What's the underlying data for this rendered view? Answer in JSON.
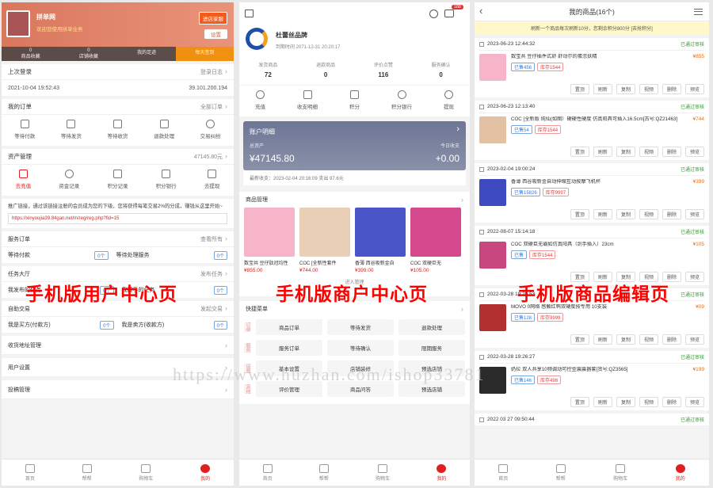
{
  "user_center": {
    "shop_name": "拼单网",
    "greeting": "欢迎您使用拼单业务",
    "btn_enter_shop": "进店家服",
    "btn_settings": "设置",
    "stats": [
      {
        "value": "0",
        "label": "商品收藏"
      },
      {
        "value": "0",
        "label": "店铺收藏"
      },
      {
        "value": "",
        "label": "我的足迹"
      },
      {
        "value": "",
        "label": "每天签到"
      }
    ],
    "last_login_label": "上次登录",
    "login_log": "登录日志",
    "login_time": "2021-10-04 19:52:43",
    "login_ip": "39.101.200.194",
    "orders_title": "我的订单",
    "orders_all": "全部订单",
    "order_items": [
      "等待付款",
      "等待发货",
      "等待收货",
      "退款处理",
      "交易纠纷"
    ],
    "assets_title": "资产管理",
    "assets_total": "47145.80元",
    "asset_items": [
      "去充值",
      "资金记录",
      "积分记录",
      "积分银行",
      "去提现"
    ],
    "promo_text": "推广链接，通过该链接注册的会员成为您的下级，您将获得每笔交易2%的分成，赚钱从这里开始~",
    "promo_url": "https://xinyoujia39.84gan.net/m/reg/reg.php?fid=15",
    "service_title": "服务订单",
    "service_link": "查看所有",
    "service_rows": [
      {
        "left": "等待付款",
        "lc": "0个",
        "right": "等待处理服务",
        "rc": "0个"
      }
    ],
    "task_title": "任务大厅",
    "task_link": "发布任务",
    "task_rows": [
      {
        "left": "我发布的任务",
        "lc": "0个",
        "right": "我接手的任务",
        "rc": "0个"
      }
    ],
    "auto_title": "自助交易",
    "auto_link": "发起交易",
    "auto_rows": [
      {
        "left": "我是买方(付款方)",
        "lc": "0个",
        "right": "我是卖方(收款方)",
        "rc": "0个"
      }
    ],
    "links": [
      "收货地址管理",
      "用户设置",
      "投稿管理"
    ],
    "overlay": "手机版用户中心页"
  },
  "merchant_center": {
    "shop_name": "杜蕾丝品牌",
    "expire": "到期时间 2071-12-31 20:20:17",
    "stats": [
      {
        "label": "发货商品",
        "value": "72"
      },
      {
        "label": "退款商品",
        "value": "0"
      },
      {
        "label": "评价点赞",
        "value": "116"
      },
      {
        "label": "服务确认",
        "value": "0"
      }
    ],
    "msg_badge": "188",
    "quick": [
      "充值",
      "收支明细",
      "积分",
      "积分银行",
      "提现"
    ],
    "account_title": "账户明细",
    "total_label": "总资产",
    "total_value": "¥47145.80",
    "today_label": "今日收支",
    "today_value": "+0.00",
    "latest": "最新收支：2023-02-04 20:16:09 支出 97.6元",
    "goods_title": "商品管理",
    "goods": [
      {
        "name": "数宝共 豆仔肽冠均性",
        "price": "¥855.00",
        "color": "#f6b5c8"
      },
      {
        "name": "COC [全新性套件",
        "price": "¥744.00",
        "color": "#e8cfb6"
      },
      {
        "name": "香薄 西谷吸新金自",
        "price": "¥399.00",
        "color": "#4a55c8"
      },
      {
        "name": "COC 双硬巨无",
        "price": "¥105.00",
        "color": "#d54a8c"
      }
    ],
    "goods_more": "进入管理",
    "menu_title": "快捷菜单",
    "menu_groups": [
      {
        "tag": "订单",
        "items": [
          "商品订单",
          "等待发货",
          "退款处理"
        ]
      },
      {
        "tag": "服务",
        "items": [
          "服务订单",
          "等待确认",
          "限期服务"
        ]
      },
      {
        "tag": "设置",
        "items": [
          "基本设置",
          "店铺装修",
          "预选店铺"
        ]
      },
      {
        "tag": "其他",
        "items": [
          "评价管理",
          "商品问答",
          "预选店铺"
        ]
      }
    ],
    "overlay": "手机版商户中心页"
  },
  "goods_edit": {
    "title": "我的商品(16个)",
    "notice": "刷新一个商品每次刷新10分，您剩余积分800分 [去抢积分]",
    "products": [
      {
        "date": "2023-06-23 12:44:32",
        "status": "已通过审核",
        "name": "数宝共 豆仔插件式舒 舒动尔的蛋恣妖精",
        "price": "¥855",
        "pv": "已售456",
        "stock": "库存1544",
        "color": "#f6b5c8"
      },
      {
        "date": "2023-06-23 12:13:40",
        "status": "已通过审核",
        "name": "COC [全新版 纯仙(如图）硬硬性硬度 仿真阳具可插入16.5cm[古号:QZ21463]",
        "price": "¥744",
        "pv": "已售54",
        "stock": "库存1544",
        "color": "#e3c2a4"
      },
      {
        "date": "2023-02-04 19:00:24",
        "status": "已通过审核",
        "name": "香薄 西谷吸新金自动伸缩互动按摩飞机杯",
        "price": "¥399",
        "pv": "已售15826",
        "stock": "库存9997",
        "color": "#3e4bc0"
      },
      {
        "date": "2022-08-07 15:14:18",
        "status": "已通过审核",
        "name": "COC 双硬巨无霸如仿真阳具（剑手插入）23cm",
        "price": "¥105",
        "pv": "已售",
        "stock": "库存1544",
        "color": "#c9477f"
      },
      {
        "date": "2022-03-28 19:26:53",
        "status": "已通过审核",
        "name": "MOVO 0网络 感触红鸭双硬度按专用 10支装",
        "price": "¥09",
        "pv": "已售128",
        "stock": "库存9999",
        "color": "#b33030"
      },
      {
        "date": "2022-03-28 19:26:27",
        "status": "已通过审核",
        "name": "奶拉 双人共享10频调动可控型震震器套[货号:QZ3565]",
        "price": "¥199",
        "pv": "已售146",
        "stock": "库存498",
        "color": "#2a2a2a"
      }
    ],
    "last_date": "2022 03 27 09:50:44",
    "last_status": "已通过审核",
    "actions": [
      "置顶",
      "刷新",
      "复制",
      "视频",
      "删除",
      "预览"
    ],
    "overlay": "手机版商品编辑页"
  },
  "tabs": [
    "首页",
    "帮帮",
    "购物车",
    "我的"
  ],
  "watermark": "https://www.huzhan.com/ishop33781"
}
